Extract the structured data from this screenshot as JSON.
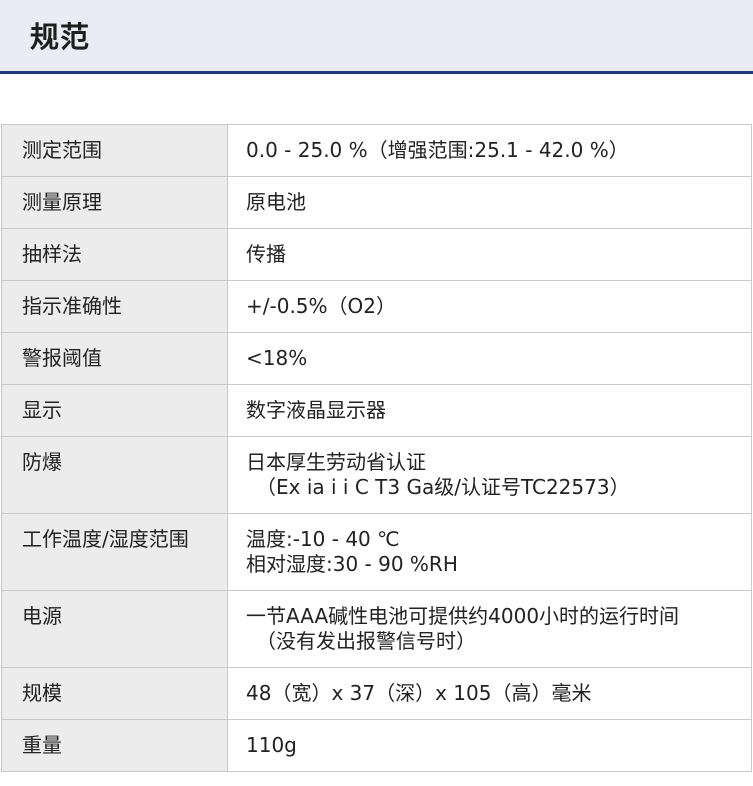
{
  "page": {
    "title": "规范"
  },
  "specs": [
    {
      "label": "测定范围",
      "lines": [
        "0.0 - 25.0 %（增强范围:25.1 - 42.0 %）"
      ]
    },
    {
      "label": "测量原理",
      "lines": [
        "原电池"
      ]
    },
    {
      "label": "抽样法",
      "lines": [
        "传播"
      ]
    },
    {
      "label": "指示准确性",
      "lines": [
        "+/-0.5%（O2）"
      ]
    },
    {
      "label": "警报阈值",
      "lines": [
        "<18%"
      ]
    },
    {
      "label": "显示",
      "lines": [
        "数字液晶显示器"
      ]
    },
    {
      "label": "防爆",
      "lines": [
        "日本厚生劳动省认证",
        "（Ex ia i i C T3 Ga级/认证号TC22573）"
      ]
    },
    {
      "label": "工作温度/湿度范围",
      "lines": [
        "温度:-10 - 40 ℃",
        "相对湿度:30 - 90 %RH"
      ]
    },
    {
      "label": "电源",
      "lines": [
        "一节AAA碱性电池可提供约4000小时的运行时间",
        "（没有发出报警信号时）"
      ]
    },
    {
      "label": "规模",
      "lines": [
        "48（宽）x 37（深）x 105（高）毫米"
      ]
    },
    {
      "label": "重量",
      "lines": [
        "110g"
      ]
    }
  ]
}
